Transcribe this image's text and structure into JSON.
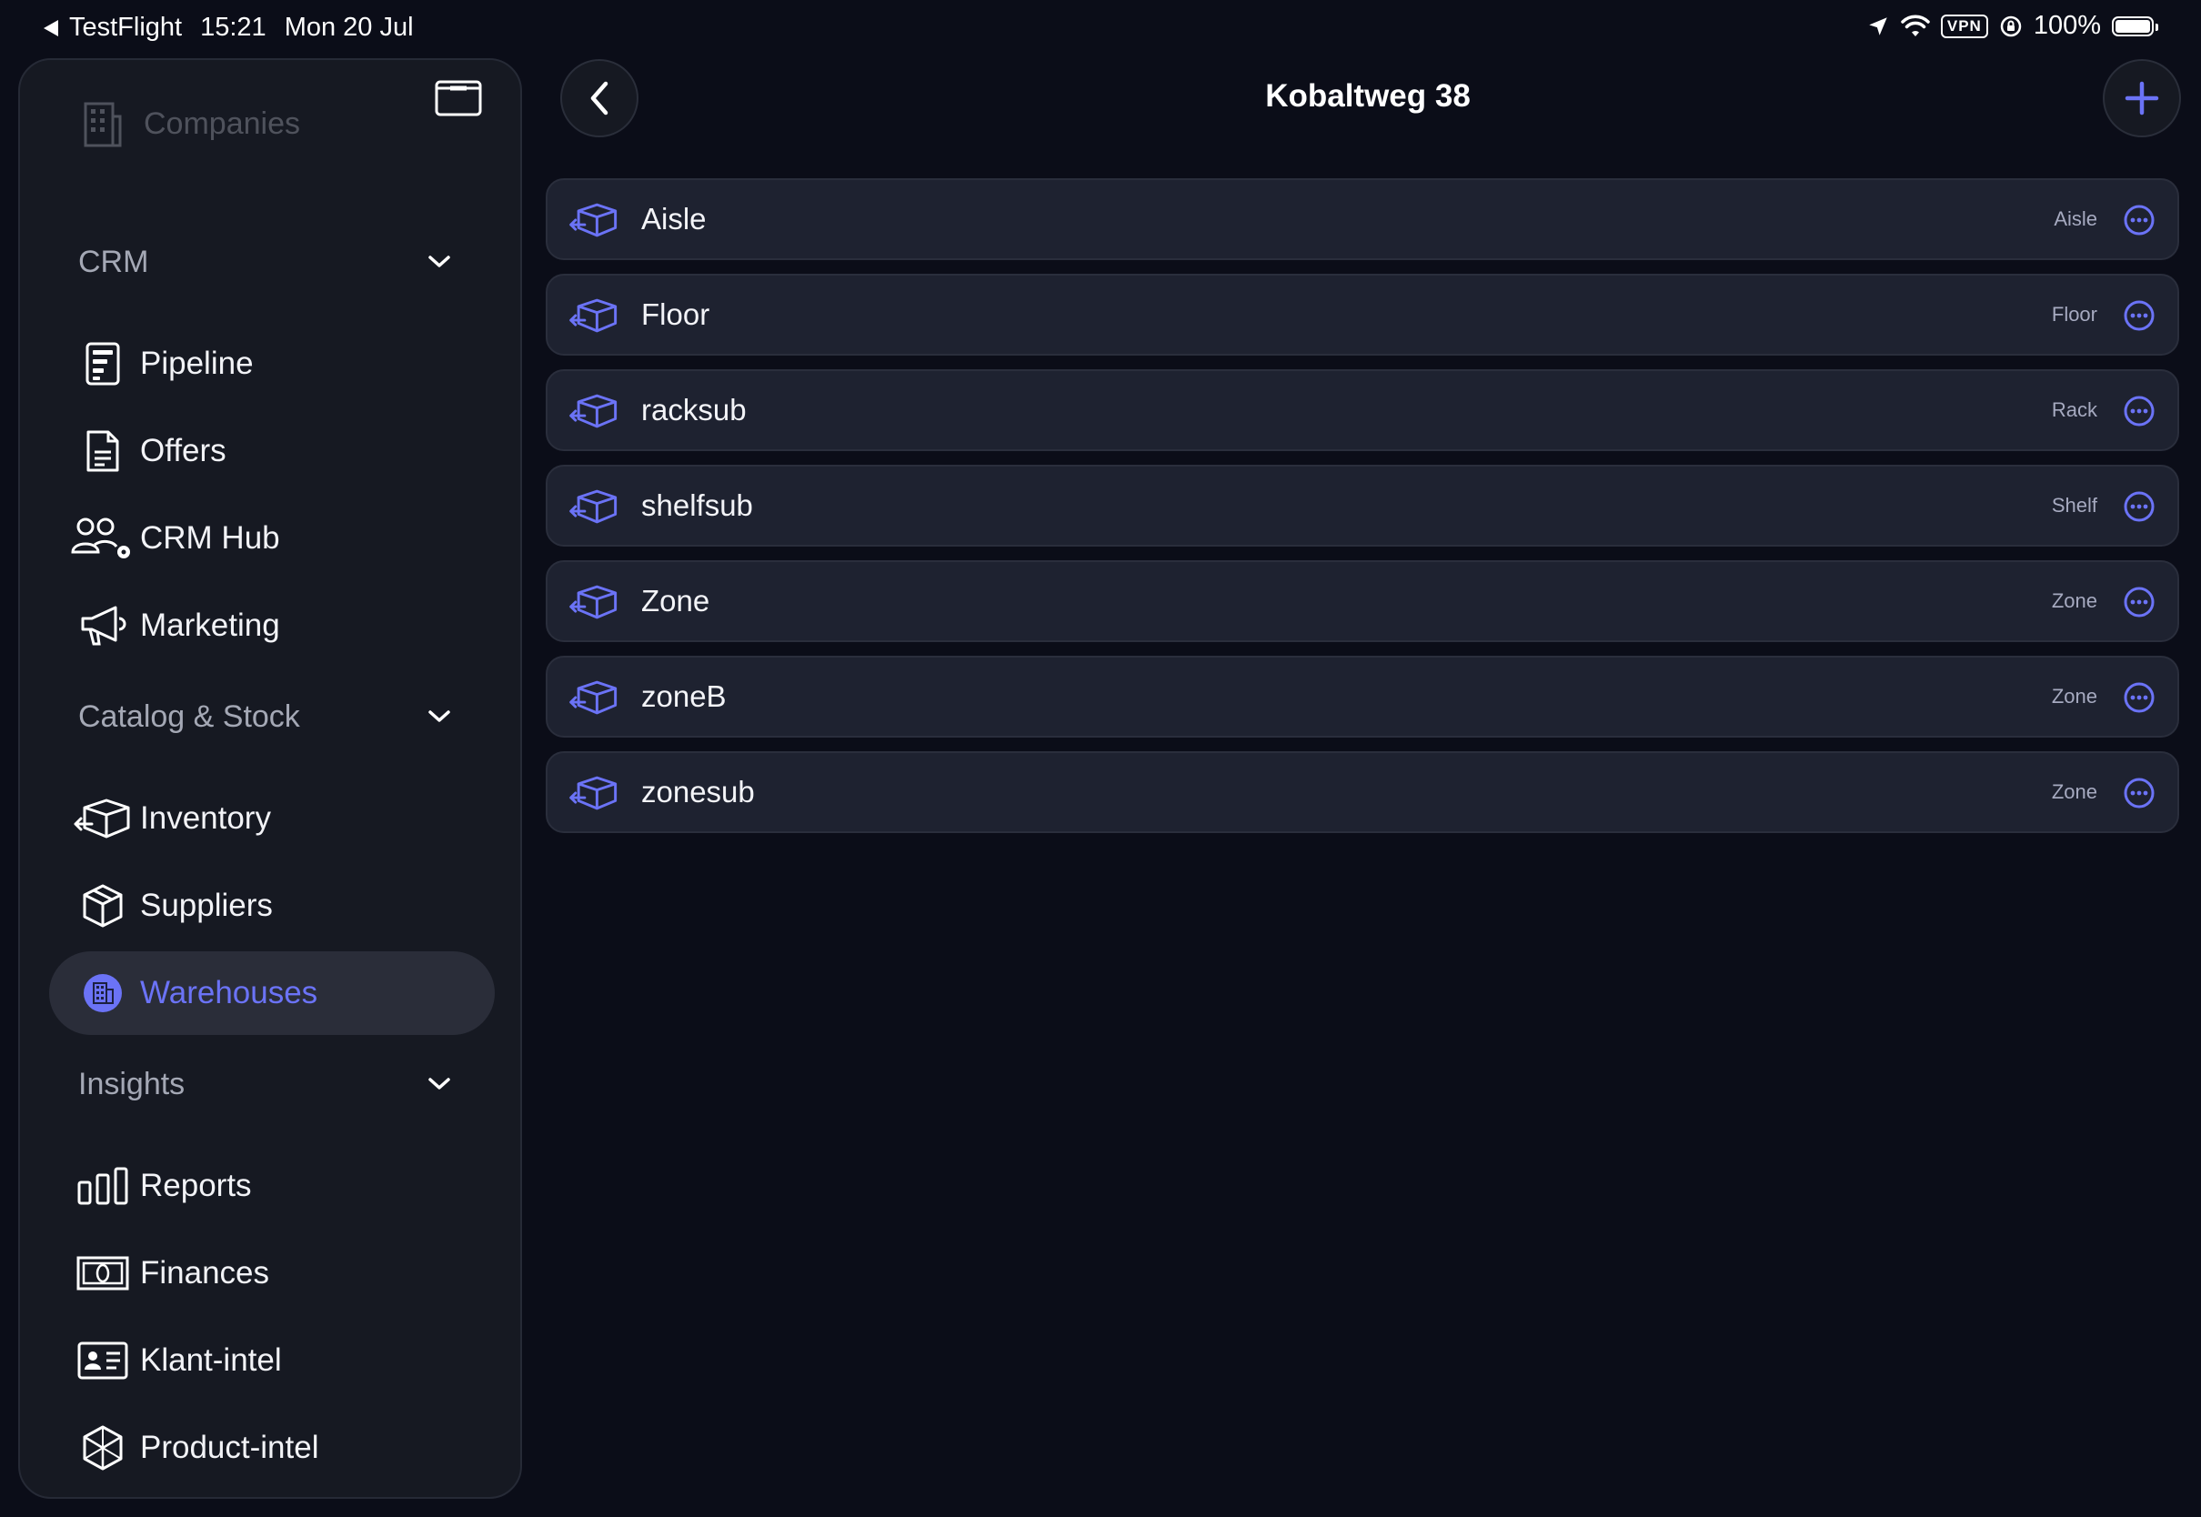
{
  "status_bar": {
    "back_app": "TestFlight",
    "time": "15:21",
    "date": "Mon 20 Jul",
    "vpn": "VPN",
    "battery": "100%"
  },
  "sidebar": {
    "faded_item": {
      "label": "Companies",
      "icon": "building-icon"
    },
    "sections": [
      {
        "title": "CRM",
        "items": [
          {
            "label": "Pipeline",
            "icon": "pipeline-icon"
          },
          {
            "label": "Offers",
            "icon": "document-icon"
          },
          {
            "label": "CRM Hub",
            "icon": "people-gear-icon"
          },
          {
            "label": "Marketing",
            "icon": "megaphone-icon"
          }
        ]
      },
      {
        "title": "Catalog & Stock",
        "items": [
          {
            "label": "Inventory",
            "icon": "box-arrow-icon"
          },
          {
            "label": "Suppliers",
            "icon": "box-icon"
          },
          {
            "label": "Warehouses",
            "icon": "warehouse-icon",
            "active": true
          }
        ]
      },
      {
        "title": "Insights",
        "items": [
          {
            "label": "Reports",
            "icon": "bar-chart-icon"
          },
          {
            "label": "Finances",
            "icon": "banknote-icon"
          },
          {
            "label": "Klant-intel",
            "icon": "id-card-icon"
          },
          {
            "label": "Product-intel",
            "icon": "cube-icon"
          }
        ]
      }
    ]
  },
  "main": {
    "title": "Kobaltweg 38",
    "locations": [
      {
        "name": "Aisle",
        "type": "Aisle"
      },
      {
        "name": "Floor",
        "type": "Floor"
      },
      {
        "name": "racksub",
        "type": "Rack"
      },
      {
        "name": "shelfsub",
        "type": "Shelf"
      },
      {
        "name": "Zone",
        "type": "Zone"
      },
      {
        "name": "zoneB",
        "type": "Zone"
      },
      {
        "name": "zonesub",
        "type": "Zone"
      }
    ]
  },
  "colors": {
    "background": "#0b0d18",
    "sidebar": "#161922",
    "row": "#1e2230",
    "accent": "#6b73f6"
  }
}
